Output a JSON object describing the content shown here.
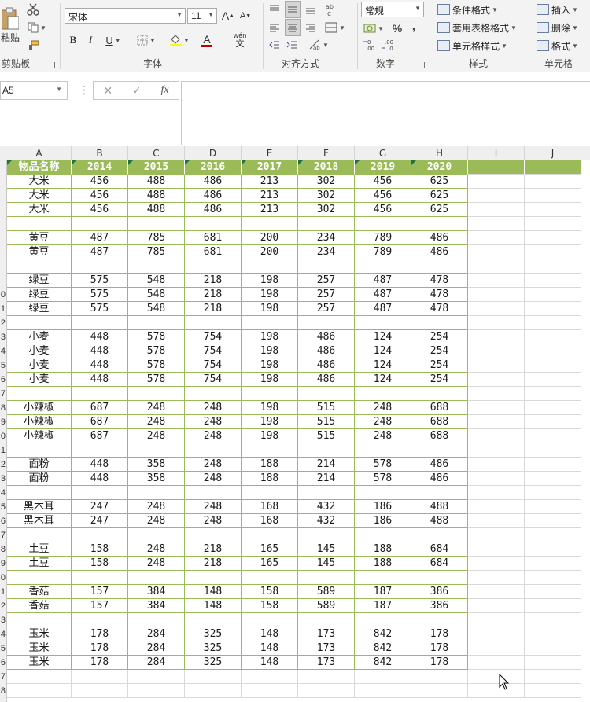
{
  "ribbon": {
    "clipboard": {
      "paste_label": "粘贴",
      "group_label": "剪贴板"
    },
    "font": {
      "font_name": "宋体",
      "font_size": "11",
      "bold": "B",
      "italic": "I",
      "underline": "U",
      "font_color_glyph": "A",
      "phonetic_top": "wén",
      "phonetic_bottom": "文",
      "grow": "A",
      "shrink": "A",
      "group_label": "字体"
    },
    "alignment": {
      "group_label": "对齐方式"
    },
    "number": {
      "format": "常规",
      "percent": "%",
      "comma": ",",
      "group_label": "数字"
    },
    "styles": {
      "conditional": "条件格式",
      "table_format": "套用表格格式",
      "cell_styles": "单元格样式",
      "group_label": "样式"
    },
    "cells": {
      "insert": "插入",
      "delete": "删除",
      "format": "格式",
      "group_label": "单元格"
    }
  },
  "formula_bar": {
    "name_box": "A5",
    "cancel": "✕",
    "enter": "✓",
    "fx": "fx",
    "value": ""
  },
  "columns": [
    "A",
    "B",
    "C",
    "D",
    "E",
    "F",
    "G",
    "H",
    "I",
    "J"
  ],
  "row_numbers": [
    "",
    "",
    "",
    "",
    "",
    "",
    "",
    "",
    "",
    "0",
    "1",
    "2",
    "3",
    "4",
    "5",
    "6",
    "7",
    "8",
    "9",
    "0",
    "1",
    "2",
    "3",
    "4",
    "5",
    "6",
    "7",
    "8",
    "9",
    "0",
    "1",
    "2",
    "3",
    "4",
    "5",
    "6",
    "7",
    "8"
  ],
  "headers": [
    "物品名称",
    "2014",
    "2015",
    "2016",
    "2017",
    "2018",
    "2019",
    "2020"
  ],
  "rows": [
    [
      "大米",
      "456",
      "488",
      "486",
      "213",
      "302",
      "456",
      "625"
    ],
    [
      "大米",
      "456",
      "488",
      "486",
      "213",
      "302",
      "456",
      "625"
    ],
    [
      "大米",
      "456",
      "488",
      "486",
      "213",
      "302",
      "456",
      "625"
    ],
    [],
    [
      "黄豆",
      "487",
      "785",
      "681",
      "200",
      "234",
      "789",
      "486"
    ],
    [
      "黄豆",
      "487",
      "785",
      "681",
      "200",
      "234",
      "789",
      "486"
    ],
    [],
    [
      "绿豆",
      "575",
      "548",
      "218",
      "198",
      "257",
      "487",
      "478"
    ],
    [
      "绿豆",
      "575",
      "548",
      "218",
      "198",
      "257",
      "487",
      "478"
    ],
    [
      "绿豆",
      "575",
      "548",
      "218",
      "198",
      "257",
      "487",
      "478"
    ],
    [],
    [
      "小麦",
      "448",
      "578",
      "754",
      "198",
      "486",
      "124",
      "254"
    ],
    [
      "小麦",
      "448",
      "578",
      "754",
      "198",
      "486",
      "124",
      "254"
    ],
    [
      "小麦",
      "448",
      "578",
      "754",
      "198",
      "486",
      "124",
      "254"
    ],
    [
      "小麦",
      "448",
      "578",
      "754",
      "198",
      "486",
      "124",
      "254"
    ],
    [],
    [
      "小辣椒",
      "687",
      "248",
      "248",
      "198",
      "515",
      "248",
      "688"
    ],
    [
      "小辣椒",
      "687",
      "248",
      "248",
      "198",
      "515",
      "248",
      "688"
    ],
    [
      "小辣椒",
      "687",
      "248",
      "248",
      "198",
      "515",
      "248",
      "688"
    ],
    [],
    [
      "面粉",
      "448",
      "358",
      "248",
      "188",
      "214",
      "578",
      "486"
    ],
    [
      "面粉",
      "448",
      "358",
      "248",
      "188",
      "214",
      "578",
      "486"
    ],
    [],
    [
      "黑木耳",
      "247",
      "248",
      "248",
      "168",
      "432",
      "186",
      "488"
    ],
    [
      "黑木耳",
      "247",
      "248",
      "248",
      "168",
      "432",
      "186",
      "488"
    ],
    [],
    [
      "土豆",
      "158",
      "248",
      "218",
      "165",
      "145",
      "188",
      "684"
    ],
    [
      "土豆",
      "158",
      "248",
      "218",
      "165",
      "145",
      "188",
      "684"
    ],
    [],
    [
      "香菇",
      "157",
      "384",
      "148",
      "158",
      "589",
      "187",
      "386"
    ],
    [
      "香菇",
      "157",
      "384",
      "148",
      "158",
      "589",
      "187",
      "386"
    ],
    [],
    [
      "玉米",
      "178",
      "284",
      "325",
      "148",
      "173",
      "842",
      "178"
    ],
    [
      "玉米",
      "178",
      "284",
      "325",
      "148",
      "173",
      "842",
      "178"
    ],
    [
      "玉米",
      "178",
      "284",
      "325",
      "148",
      "173",
      "842",
      "178"
    ]
  ],
  "colors": {
    "header_bg": "#9bbb59",
    "header_text": "#ffffff",
    "grid_line": "#d9d9d9",
    "table_border": "#9bbb59"
  }
}
